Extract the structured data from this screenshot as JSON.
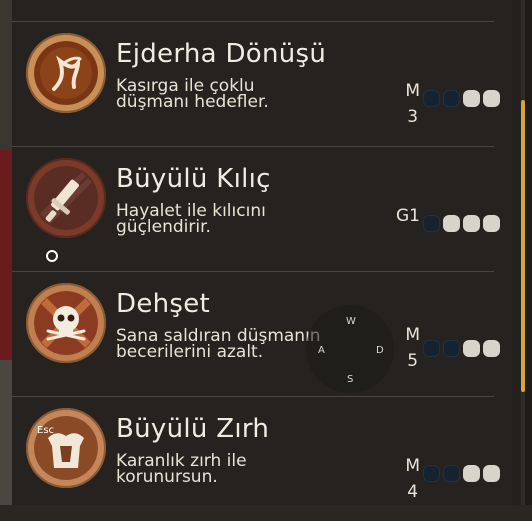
{
  "abilities": [
    {
      "title": "Ejderha Dönüşü",
      "desc": "Kasırga ile çoklu düşmanı hedefler.",
      "key": "M",
      "key_sub": "3",
      "pips": [
        "empty",
        "empty",
        "full",
        "full"
      ],
      "icon": "dragon-claw-icon"
    },
    {
      "title": "Büyülü Kılıç",
      "desc": "Hayalet ile kılıcını güçlendirir.",
      "key": "G1",
      "key_sub": "",
      "pips": [
        "empty",
        "full",
        "full",
        "full"
      ],
      "icon": "magic-sword-icon"
    },
    {
      "title": "Dehşet",
      "desc": "Sana saldıran düşmanın becerilerini azalt.",
      "key": "M",
      "key_sub": "5",
      "pips": [
        "empty",
        "empty",
        "full",
        "full"
      ],
      "icon": "skull-icon"
    },
    {
      "title": "Büyülü Zırh",
      "desc": "Karanlık zırh ile korunursun.",
      "key": "M",
      "key_sub": "4",
      "pips": [
        "empty",
        "empty",
        "full",
        "full"
      ],
      "icon": "magic-armor-icon"
    }
  ],
  "compass": {
    "n": "W",
    "w": "A",
    "e": "D",
    "s": "S"
  },
  "overlay": {
    "esc": "Esc"
  },
  "colors": {
    "accent": "#d7a33c",
    "pip_full": "#d8d4cc",
    "pip_empty": "#152330"
  }
}
